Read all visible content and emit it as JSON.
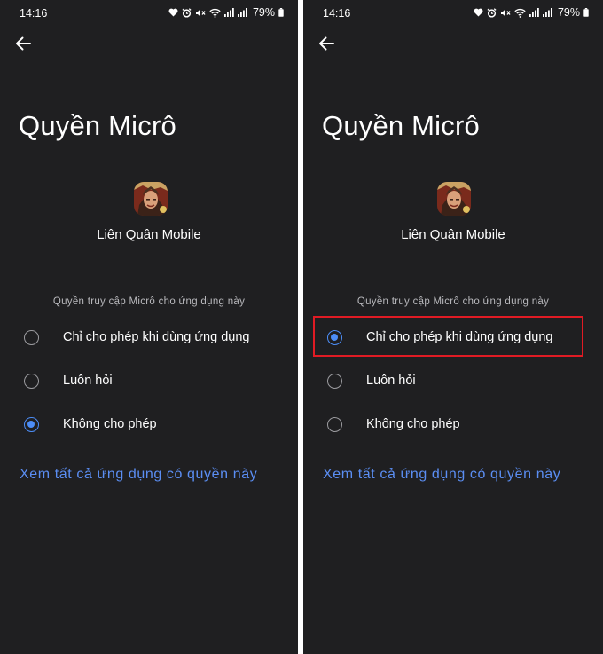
{
  "screens": [
    {
      "status": {
        "time": "14:16",
        "battery": "79%"
      },
      "title": "Quyền Micrô",
      "app_name": "Liên Quân Mobile",
      "section_label": "Quyền truy cập Micrô cho ứng dụng này",
      "options": [
        {
          "label": "Chỉ cho phép khi dùng ứng dụng",
          "selected": false
        },
        {
          "label": "Luôn hỏi",
          "selected": false
        },
        {
          "label": "Không cho phép",
          "selected": true
        }
      ],
      "link": "Xem tất cả ứng dụng có quyền này"
    },
    {
      "status": {
        "time": "14:16",
        "battery": "79%"
      },
      "title": "Quyền Micrô",
      "app_name": "Liên Quân Mobile",
      "section_label": "Quyền truy cập Micrô cho ứng dụng này",
      "options": [
        {
          "label": "Chỉ cho phép khi dùng ứng dụng",
          "selected": true
        },
        {
          "label": "Luôn hỏi",
          "selected": false
        },
        {
          "label": "Không cho phép",
          "selected": false
        }
      ],
      "link": "Xem tất cả ứng dụng có quyền này"
    }
  ],
  "colors": {
    "background": "#1f1f21",
    "accent": "#4c8df7",
    "link": "#5b8ef3",
    "highlight": "#e01b24"
  },
  "icons": [
    "back-arrow-icon",
    "heart-icon",
    "alarm-icon",
    "mute-icon",
    "wifi-icon",
    "signal-icon",
    "battery-icon",
    "radio-button"
  ]
}
